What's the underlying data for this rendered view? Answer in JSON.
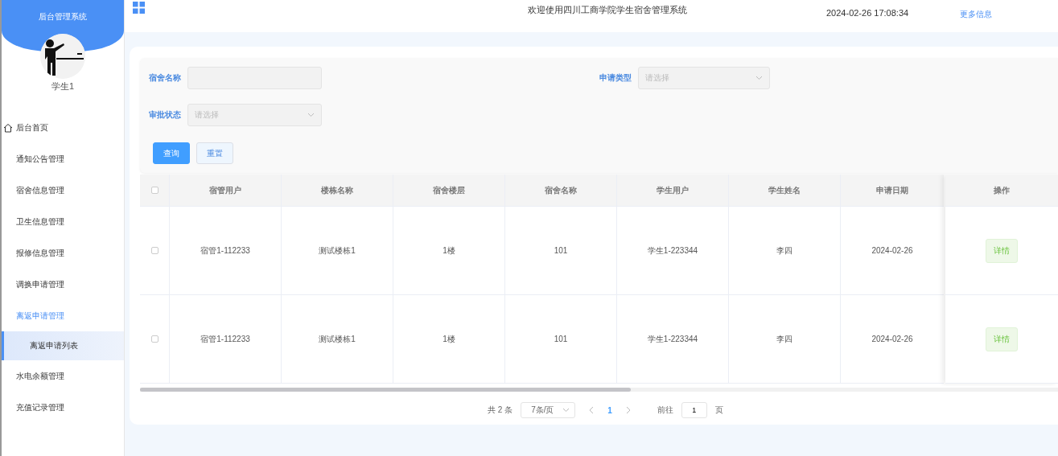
{
  "sidebar": {
    "title": "后台管理系统",
    "user_name": "学生1",
    "menu": [
      {
        "label": "后台首页",
        "kind": "link",
        "expanded": false
      },
      {
        "label": "通知公告管理",
        "kind": "group",
        "expanded": false
      },
      {
        "label": "宿舍信息管理",
        "kind": "group",
        "expanded": false
      },
      {
        "label": "卫生信息管理",
        "kind": "group",
        "expanded": false
      },
      {
        "label": "报修信息管理",
        "kind": "group",
        "expanded": false
      },
      {
        "label": "调换申请管理",
        "kind": "group",
        "expanded": false
      },
      {
        "label": "离返申请管理",
        "kind": "group",
        "expanded": true,
        "children": [
          {
            "label": "离返申请列表",
            "selected": true
          }
        ]
      },
      {
        "label": "水电余额管理",
        "kind": "group",
        "expanded": false
      },
      {
        "label": "充值记录管理",
        "kind": "group",
        "expanded": false
      }
    ]
  },
  "header": {
    "title": "欢迎使用四川工商学院学生宿舍管理系统",
    "datetime": "2024-02-26 17:08:34",
    "link": "更多信息"
  },
  "search": {
    "fields": [
      {
        "label": "宿舍名称",
        "kind": "text"
      },
      {
        "label": "申请类型",
        "kind": "select",
        "placeholder": "请选择"
      },
      {
        "label": "审批状态",
        "kind": "select",
        "placeholder": "请选择"
      }
    ],
    "buttons": [
      {
        "label": "查询",
        "kind": "primary"
      },
      {
        "label": "重置",
        "kind": "plain"
      }
    ]
  },
  "table": {
    "all_checked": false,
    "columns": [
      "宿管用户",
      "楼栋名称",
      "宿舍楼层",
      "宿舍名称",
      "学生用户",
      "学生姓名",
      "申请日期"
    ],
    "action_column": "操作",
    "rows": [
      {
        "checked": false,
        "cells": [
          "宿管1-112233",
          "测试楼栋1",
          "1楼",
          "101",
          "学生1-223344",
          "李四",
          "2024-02-26"
        ],
        "action": "详情"
      },
      {
        "checked": false,
        "cells": [
          "宿管1-112233",
          "测试楼栋1",
          "1楼",
          "101",
          "学生1-223344",
          "李四",
          "2024-02-26"
        ],
        "action": "详情"
      }
    ]
  },
  "pagination": {
    "total": "共 2 条",
    "page_size": "7条/页",
    "pages": [
      {
        "label": "1",
        "selected": true
      }
    ],
    "goto_label": "前往",
    "goto_value": "1",
    "goto_suffix": "页"
  }
}
